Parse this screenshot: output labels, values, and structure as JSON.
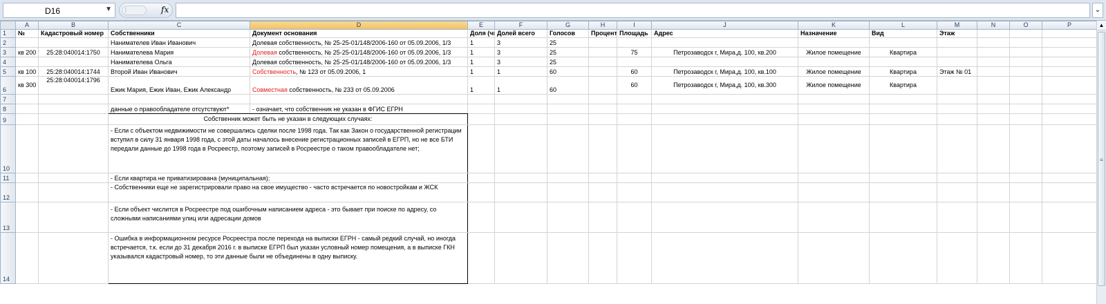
{
  "formula_bar": {
    "name_box": "D16",
    "fx_label": "fx",
    "formula": ""
  },
  "columns": [
    "A",
    "B",
    "C",
    "D",
    "E",
    "F",
    "G",
    "H",
    "I",
    "J",
    "K",
    "L",
    "M",
    "N",
    "O",
    "P"
  ],
  "rows": {
    "r1": {
      "n": "1",
      "A": "№",
      "B": "Кадастровый номер",
      "C": "Собственники",
      "D": "Документ основания",
      "E": "Доля (чи",
      "F": "Долей всего",
      "G": "Голосов",
      "H": "Процент",
      "I": "Площадь",
      "J": "Адрес",
      "K": "Назначение",
      "L": "Вид",
      "M": "Этаж"
    },
    "r2": {
      "n": "2",
      "C": "Нанимателев Иван Иванович",
      "D": "Долевая собственность, № 25-25-01/148/2006-160 от 05.09.2006, 1/3",
      "E": "1",
      "F": "3",
      "G": "25"
    },
    "r3": {
      "n": "3",
      "A": "кв 200",
      "B": "25:28:040014:1750",
      "C": "Нанимателева Мария",
      "D_red": "Долевая",
      "D_rest": " собственность, № 25-25-01/148/2006-160 от 05.09.2006, 1/3",
      "E": "1",
      "F": "3",
      "G": "25",
      "I": "75",
      "J": "Петрозаводск г, Мира,д. 100, кв.200",
      "K": "Жилое помещение",
      "L": "Квартира"
    },
    "r4": {
      "n": "4",
      "C": "Нанимателева Ольга",
      "D": "Долевая собственность, № 25-25-01/148/2006-160 от 05.09.2006, 1/3",
      "E": "1",
      "F": "3",
      "G": "25"
    },
    "r5": {
      "n": "5",
      "A": "кв 100",
      "B": "25:28:040014:1744",
      "C": "Второй Иван Иванович",
      "D_red": "Собственность",
      "D_rest": ", № 123  от 05.09.2006, 1",
      "E": "1",
      "F": "1",
      "G": "60",
      "I": "60",
      "J": "Петрозаводск г, Мира,д. 100, кв.100",
      "K": "Жилое помещение",
      "L": "Квартира",
      "M": "Этаж № 01"
    },
    "r6": {
      "n": "6",
      "A": "кв 300",
      "B": "25:28:040014:1796",
      "C": "Ежик Мария, Ежик Иван, Ежик Александр",
      "D_red": "Совместная",
      "D_rest": " собственность, № 233  от 05.09.2006",
      "E": "1",
      "F": "1",
      "G": "60",
      "I": "60",
      "J": "Петрозаводск г, Мира,д. 100, кв.300",
      "K": "Жилое помещение",
      "L": "Квартира"
    },
    "r7": {
      "n": "7"
    },
    "r8": {
      "n": "8",
      "C": "данные о правообладателе отсутствуют*",
      "D": " - означает, что собственник не указан в ФГИС ЕГРН"
    },
    "r9": {
      "n": "9",
      "title": "Собственник может быть не указан в следующих случаях:"
    },
    "r10": {
      "n": "10",
      "text": "- Если с объектом недвижимости не совершались сделки после 1998 года. Так как Закон о государственной регистрации вступил в силу 31 января 1998 года, с этой даты началось внесение регистрационных записей в ЕГРП, но не все БТИ передали данные до 1998 года в Росреестр, поэтому записей в Росреестре о таком правообладателе нет;"
    },
    "r11": {
      "n": "11",
      "text": "- Если квартира не приватизирована (муниципальная);"
    },
    "r12": {
      "n": "12",
      "text": "- Собственники еще не зарегистрировали право на свое имущество - часто встречается по новостройкам и ЖСК"
    },
    "r13": {
      "n": "13",
      "text": "- Если объект числится в Росреестре под ошибочным написанием адреса - это бывает при поиске по адресу, со сложными написаниями улиц или адресации домов"
    },
    "r14": {
      "n": "14",
      "text": "- Ошибка в информационном ресурсе Росреестра после перехода на выписки ЕГРН - самый редкий случай, но иногда встречается, т.к. если до 31 декабря 2016 г. в выписке ЕГРП был указан условный номер помещения, а в выписке ГКН указывался кадастровый номер, то эти данные были не объединены в одну выписку."
    }
  }
}
